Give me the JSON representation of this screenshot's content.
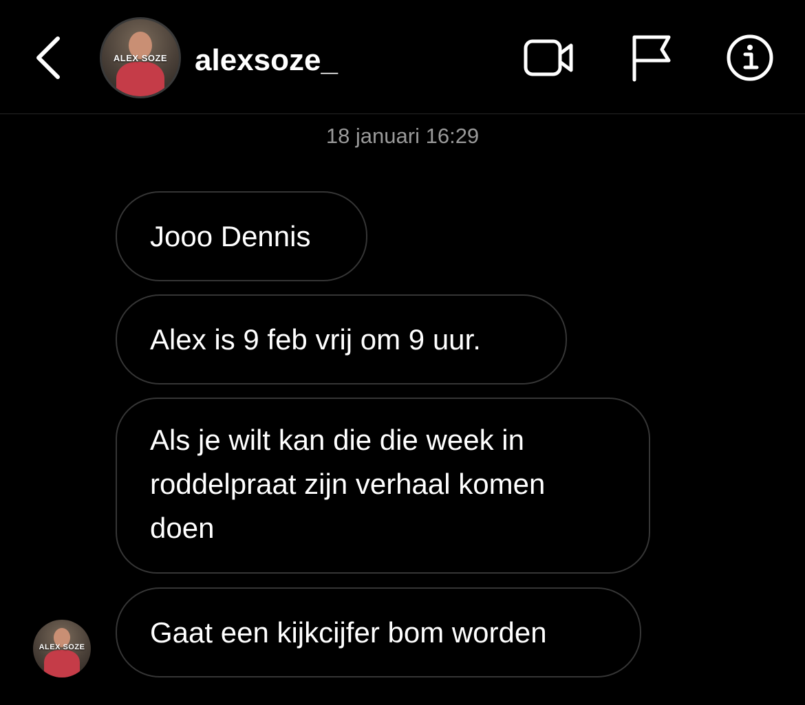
{
  "header": {
    "username": "alexsoze_",
    "avatar_logo_text": "ALEX SOZE",
    "icons": [
      "back-chevron-icon",
      "video-call-icon",
      "flag-icon",
      "info-icon"
    ]
  },
  "conversation": {
    "timestamp": "18 januari 16:29",
    "messages": [
      {
        "text": "Jooo Dennis"
      },
      {
        "text": "Alex is 9 feb vrij om 9 uur."
      },
      {
        "text": "Als je wilt kan die die week in roddelpraat zijn verhaal komen doen"
      },
      {
        "text": "Gaat een kijkcijfer bom worden"
      }
    ],
    "sender_avatar_logo_text": "ALEX SOZE"
  },
  "colors": {
    "background": "#000000",
    "text": "#ffffff",
    "timestamp": "#9a9a9a",
    "bubble_border": "#363636",
    "divider": "#262626"
  }
}
